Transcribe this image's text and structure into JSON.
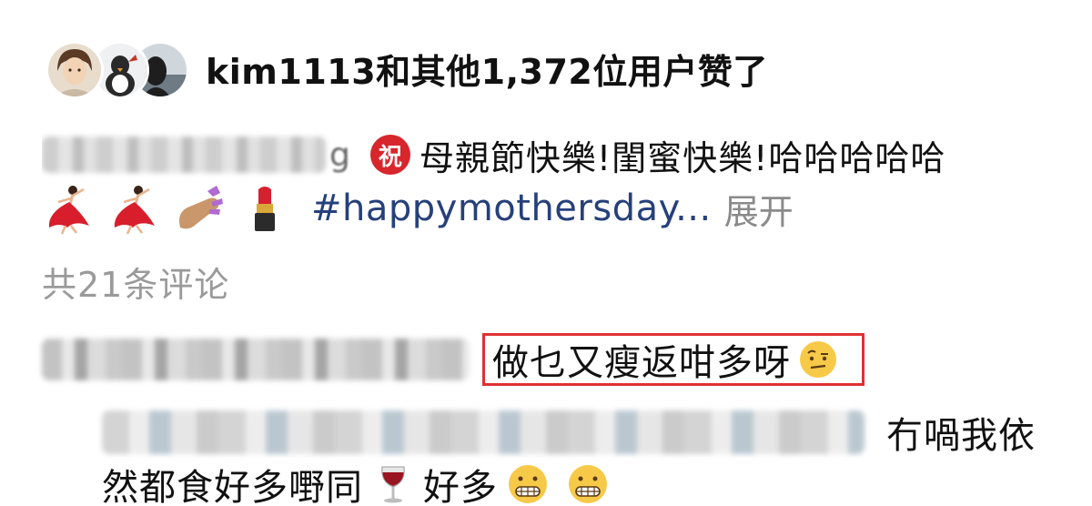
{
  "likes": {
    "avatars": [
      "avatar-photo-1",
      "avatar-photo-2",
      "avatar-photo-3"
    ],
    "text": "kim1113和其他1,372位用户赞了"
  },
  "caption": {
    "author_tail": "g",
    "badge": "祝",
    "text": "母親節快樂!閨蜜快樂!哈哈哈哈哈",
    "emojis": [
      "dancing-woman-emoji",
      "dancing-woman-emoji",
      "nail-polish-emoji",
      "lipstick-emoji"
    ],
    "hashtag": "#happymothersday...",
    "expand_label": "展开"
  },
  "comments": {
    "count_label": "共21条评论",
    "items": [
      {
        "text": "做乜又瘦返咁多呀",
        "emoji": "raised-eyebrow-emoji",
        "highlighted": true
      },
      {
        "text_line1": "冇喎我依",
        "text_line2_a": "然都食好多嘢同",
        "emoji_a": "wine-glass-emoji",
        "text_line2_b": "好多",
        "emoji_b": "grimacing-face-emoji"
      }
    ]
  },
  "colors": {
    "hashtag": "#26407a",
    "muted": "#9a9a9a",
    "highlight_border": "#e03131",
    "badge": "#d7262c"
  }
}
